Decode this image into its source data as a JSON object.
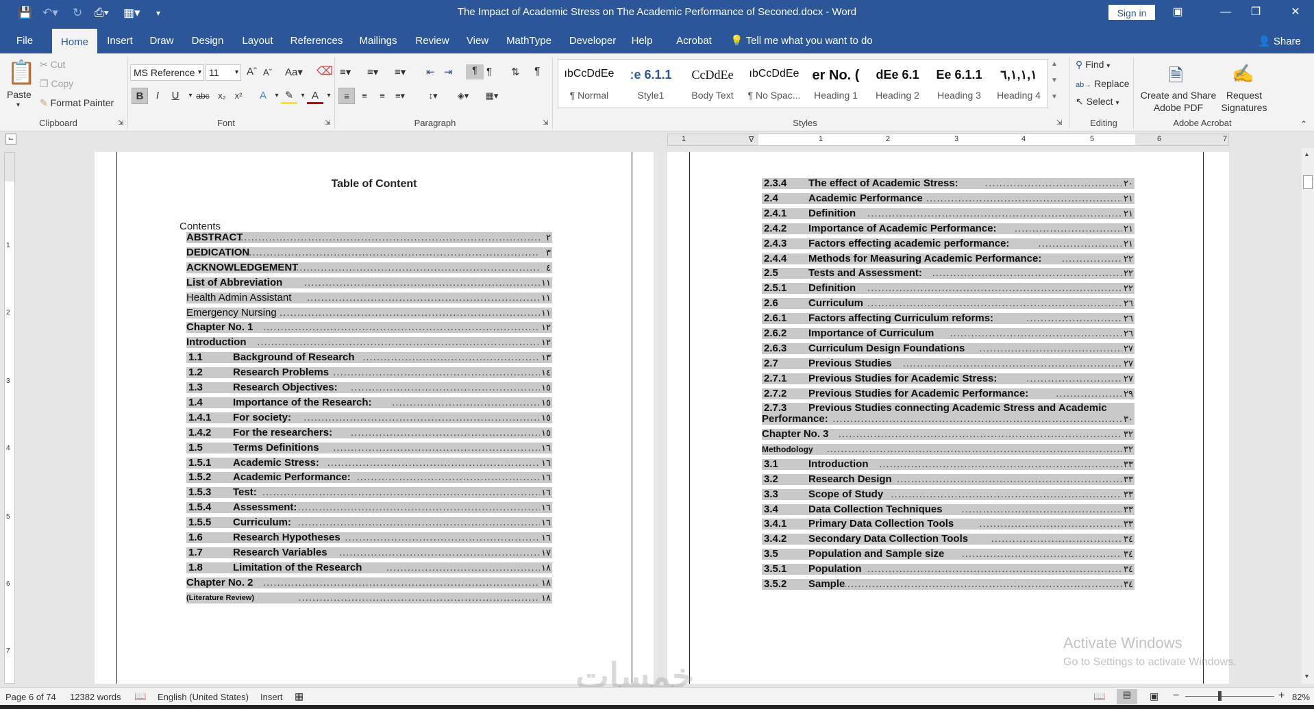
{
  "window": {
    "title": "The Impact of Academic Stress on The Academic Performance of Seconed.docx  -  Word",
    "sign_in": "Sign in"
  },
  "tabs": [
    "File",
    "Home",
    "Insert",
    "Draw",
    "Design",
    "Layout",
    "References",
    "Mailings",
    "Review",
    "View",
    "MathType",
    "Developer",
    "Help",
    "Acrobat"
  ],
  "active_tab": "Home",
  "tell_me": "Tell me what you want to do",
  "share": "Share",
  "clipboard": {
    "paste": "Paste",
    "cut": "Cut",
    "copy": "Copy",
    "format_painter": "Format Painter",
    "label": "Clipboard"
  },
  "font": {
    "name": "MS Reference",
    "size": "11",
    "label": "Font"
  },
  "paragraph": {
    "label": "Paragraph"
  },
  "styles": {
    "label": "Styles",
    "items": [
      {
        "preview": "ıbCcDdEe",
        "name": "¶ Normal"
      },
      {
        "preview": "ːe  6.1.1",
        "name": "Style1"
      },
      {
        "preview": "CcDdEe",
        "name": "Body Text"
      },
      {
        "preview": "ıbCcDdEe",
        "name": "¶ No Spac..."
      },
      {
        "preview": "er No. (",
        "name": "Heading 1"
      },
      {
        "preview": "dEe  6.1",
        "name": "Heading 2"
      },
      {
        "preview": "Ee  6.1.1",
        "name": "Heading 3"
      },
      {
        "preview": "٦,١,١,١",
        "name": "Heading 4"
      }
    ]
  },
  "editing": {
    "find": "Find",
    "replace": "Replace",
    "select": "Select",
    "label": "Editing"
  },
  "acrobat": {
    "create_share": "Create and Share",
    "adobe_pdf": "Adobe PDF",
    "request": "Request",
    "signatures": "Signatures",
    "label": "Adobe Acrobat"
  },
  "left_page": {
    "heading": "Table of Content",
    "contents_label": "Contents",
    "rows": [
      {
        "num": "",
        "label": "ABSTRACT",
        "bold": true,
        "page": "٢"
      },
      {
        "num": "",
        "label": "DEDICATION",
        "bold": true,
        "page": "٣"
      },
      {
        "num": "",
        "label": "ACKNOWLEDGEMENT",
        "bold": true,
        "page": "٤"
      },
      {
        "num": "",
        "label": "List of Abbreviation",
        "bold": true,
        "page": "١١"
      },
      {
        "num": "",
        "label": "Health Admin Assistant",
        "bold": false,
        "page": "١١"
      },
      {
        "num": "",
        "label": "Emergency Nursing",
        "bold": false,
        "page": "١١"
      },
      {
        "num": "",
        "label": "Chapter No. 1",
        "bold": true,
        "page": "١٢"
      },
      {
        "num": "",
        "label": "Introduction",
        "bold": true,
        "page": "١٢"
      },
      {
        "num": "1.1",
        "label": "Background of Research",
        "bold": true,
        "page": "١٣"
      },
      {
        "num": "1.2",
        "label": "Research Problems",
        "bold": true,
        "page": "١٤"
      },
      {
        "num": "1.3",
        "label": "Research Objectives:",
        "bold": true,
        "page": "١٥"
      },
      {
        "num": "1.4",
        "label": "Importance of the Research:",
        "bold": true,
        "page": "١٥"
      },
      {
        "num": "1.4.1",
        "label": "For society:",
        "bold": true,
        "page": "١٥"
      },
      {
        "num": "1.4.2",
        "label": "For the researchers:",
        "bold": true,
        "page": "١٥"
      },
      {
        "num": "1.5",
        "label": "Terms Definitions",
        "bold": true,
        "page": "١٦"
      },
      {
        "num": "1.5.1",
        "label": "Academic Stress:",
        "bold": true,
        "page": "١٦"
      },
      {
        "num": "1.5.2",
        "label": "Academic Performance:",
        "bold": true,
        "page": "١٦"
      },
      {
        "num": "1.5.3",
        "label": "Test:",
        "bold": true,
        "page": "١٦"
      },
      {
        "num": "1.5.4",
        "label": "Assessment:",
        "bold": true,
        "page": "١٦"
      },
      {
        "num": "1.5.5",
        "label": "Curriculum:",
        "bold": true,
        "page": "١٦"
      },
      {
        "num": "1.6",
        "label": "Research Hypotheses",
        "bold": true,
        "page": "١٦"
      },
      {
        "num": "1.7",
        "label": "Research Variables",
        "bold": true,
        "page": "١٧"
      },
      {
        "num": "1.8",
        "label": "Limitation of the Research",
        "bold": true,
        "page": "١٨"
      },
      {
        "num": "",
        "label": "Chapter No. 2",
        "bold": true,
        "page": "١٨"
      },
      {
        "num": "",
        "label": "(Literature Review)",
        "bold": true,
        "page": "١٨"
      }
    ]
  },
  "right_page": {
    "rows": [
      {
        "num": "2.3.4",
        "label": "The effect of Academic Stress:",
        "page": "٢٠"
      },
      {
        "num": "2.4",
        "label": "Academic Performance",
        "page": "٢١"
      },
      {
        "num": "2.4.1",
        "label": "Definition",
        "page": "٢١"
      },
      {
        "num": "2.4.2",
        "label": "Importance of Academic Performance:",
        "page": "٢١"
      },
      {
        "num": "2.4.3",
        "label": "Factors effecting academic performance:",
        "page": "٢١"
      },
      {
        "num": "2.4.4",
        "label": "Methods for Measuring Academic Performance:",
        "page": "٢٢"
      },
      {
        "num": "2.5",
        "label": "Tests and Assessment:",
        "page": "٢٢"
      },
      {
        "num": "2.5.1",
        "label": "Definition",
        "page": "٢٢"
      },
      {
        "num": "2.6",
        "label": "Curriculum",
        "page": "٢٦"
      },
      {
        "num": "2.6.1",
        "label": "Factors affecting Curriculum reforms:",
        "page": "٢٦"
      },
      {
        "num": "2.6.2",
        "label": "Importance of Curriculum",
        "page": "٢٦"
      },
      {
        "num": "2.6.3",
        "label": "Curriculum Design Foundations",
        "page": "٢٧"
      },
      {
        "num": "2.7",
        "label": "Previous Studies",
        "page": "٢٧"
      },
      {
        "num": "2.7.1",
        "label": "Previous Studies for Academic Stress:",
        "page": "٢٧"
      },
      {
        "num": "2.7.2",
        "label": "Previous Studies for Academic Performance:",
        "page": "٢٩"
      },
      {
        "num": "2.7.3",
        "label": "Previous Studies connecting Academic Stress and Academic",
        "page": ""
      },
      {
        "num": "",
        "label": "Performance:",
        "page": "٣٠"
      },
      {
        "num": "",
        "label": "Chapter No. 3",
        "page": "٣٢"
      },
      {
        "num": "",
        "label": "Methodology",
        "page": "٣٢"
      },
      {
        "num": "3.1",
        "label": "Introduction",
        "page": "٣٣"
      },
      {
        "num": "3.2",
        "label": "Research Design",
        "page": "٣٣"
      },
      {
        "num": "3.3",
        "label": "Scope of Study",
        "page": "٣٣"
      },
      {
        "num": "3.4",
        "label": "Data Collection Techniques",
        "page": "٣٣"
      },
      {
        "num": "3.4.1",
        "label": "Primary Data Collection Tools",
        "page": "٣٣"
      },
      {
        "num": "3.4.2",
        "label": "Secondary Data Collection Tools",
        "page": "٣٤"
      },
      {
        "num": "3.5",
        "label": "Population and Sample size",
        "page": "٣٤"
      },
      {
        "num": "3.5.1",
        "label": "Population",
        "page": "٣٤"
      },
      {
        "num": "3.5.2",
        "label": "Sample",
        "page": "٣٤"
      }
    ]
  },
  "status": {
    "page": "Page 6 of 74",
    "words": "12382 words",
    "language": "English (United States)",
    "mode": "Insert",
    "zoom": "82%"
  },
  "watermark": {
    "line1": "Activate Windows",
    "line2": "Go to Settings to activate Windows."
  },
  "brand_watermark": "خمسات"
}
